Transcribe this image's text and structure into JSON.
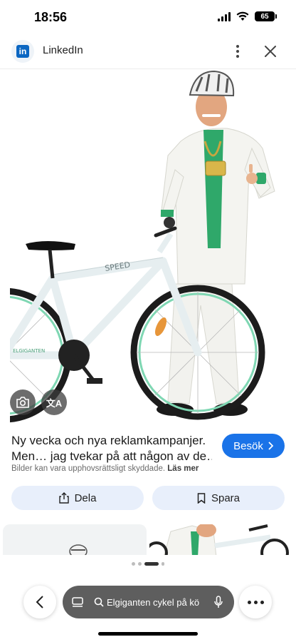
{
  "status_bar": {
    "time": "18:56",
    "battery": "65"
  },
  "header": {
    "source_name": "LinkedIn"
  },
  "image": {
    "bike_brand": "SPEED",
    "frame_label": "ELGIGANTEN",
    "translate_glyph": "文A"
  },
  "result": {
    "title_line1": "Ny vecka och nya reklamkampanjer.",
    "title_line2": "Men… jag tvekar på att någon av de…",
    "visit_label": "Besök",
    "copyright_text": "Bilder kan vara upphovsrättsligt skyddade.",
    "read_more": "Läs mer"
  },
  "actions": {
    "share_label": "Dela",
    "save_label": "Spara"
  },
  "bottom": {
    "url_text": "Elgiganten cykel på kö"
  },
  "colors": {
    "accent": "#1a73e8",
    "linkedin": "#0a66c2",
    "button_bg": "#e8effb",
    "suit_green": "#2fa86a"
  }
}
